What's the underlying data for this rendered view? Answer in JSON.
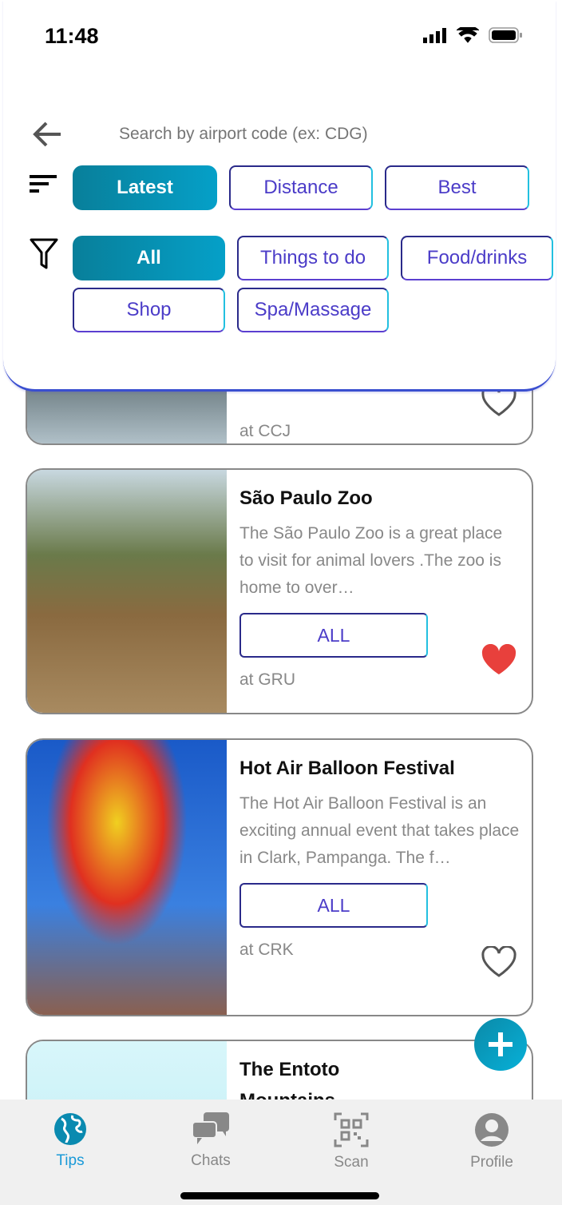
{
  "status": {
    "time": "11:48"
  },
  "search": {
    "placeholder": "Search by airport code (ex: CDG)"
  },
  "sort": {
    "options": [
      "Latest",
      "Distance",
      "Best"
    ],
    "selected": "Latest"
  },
  "filter": {
    "options": [
      "All",
      "Things to do",
      "Food/drinks",
      "Shop",
      "Spa/Massage"
    ],
    "selected": "All"
  },
  "cards": [
    {
      "title": "",
      "description": "",
      "tag": "",
      "location": "at CCJ",
      "favorite": false
    },
    {
      "title": "São Paulo Zoo",
      "description": "The São Paulo Zoo is a great place to visit for animal lovers .The zoo is home to over…",
      "tag": "ALL",
      "location": "at GRU",
      "favorite": true
    },
    {
      "title": "Hot Air Balloon Festival",
      "description": "The Hot Air Balloon Festival is an exciting annual event that takes place in Clark, Pampanga. The f…",
      "tag": "ALL",
      "location": "at CRK",
      "favorite": false
    },
    {
      "title": "The Entoto Mountains",
      "description": "",
      "tag": "",
      "location": "",
      "favorite": false
    }
  ],
  "tabs": [
    {
      "label": "Tips",
      "icon": "globe-icon",
      "active": true
    },
    {
      "label": "Chats",
      "icon": "chat-icon"
    },
    {
      "label": "Scan",
      "icon": "qr-icon"
    },
    {
      "label": "Profile",
      "icon": "profile-icon"
    }
  ],
  "colors": {
    "accent": "#0895b8",
    "heart": "#e8403c",
    "tab_active": "#1a9ad8"
  }
}
